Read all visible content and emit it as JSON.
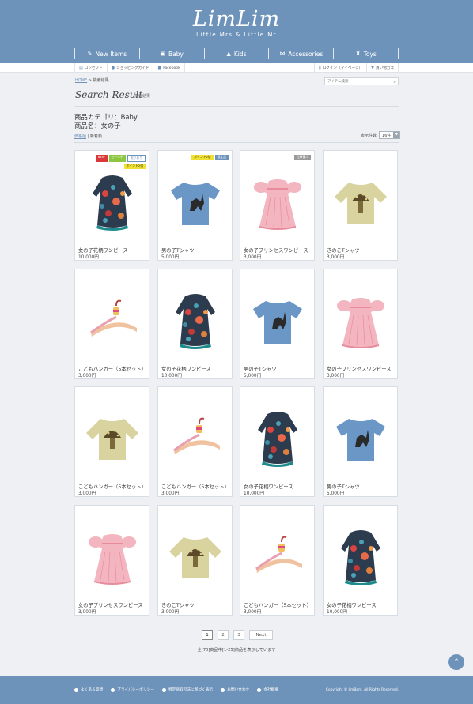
{
  "header": {
    "brand": "LimLim",
    "tagline": "Little Mrs & Little Mr",
    "nav": [
      {
        "label": "New Items",
        "icon": "pin-icon"
      },
      {
        "label": "Baby",
        "icon": "onesie-icon"
      },
      {
        "label": "Kids",
        "icon": "tshirt-icon"
      },
      {
        "label": "Accessories",
        "icon": "bow-icon"
      },
      {
        "label": "Toys",
        "icon": "toy-icon"
      }
    ]
  },
  "utility": {
    "left": [
      {
        "label": "コンセプト",
        "icon": "book-icon"
      },
      {
        "label": "ショッピングガイド",
        "icon": "info-icon"
      },
      {
        "label": "Facebook",
        "icon": "facebook-icon"
      }
    ],
    "right": [
      {
        "label": "ログイン（マイページ）",
        "icon": "lock-icon"
      },
      {
        "label": "買い物カゴ",
        "icon": "cart-icon"
      }
    ]
  },
  "breadcrumb": {
    "home": "HOME",
    "separator": ">",
    "current": "検索結果"
  },
  "search": {
    "placeholder": "アイテム検索"
  },
  "page_title": {
    "main": "Search Result",
    "sub": "検索結果"
  },
  "meta": {
    "category": "商品カテゴリ：Baby",
    "name": "商品名：女の子"
  },
  "sort": {
    "popular": "価格順",
    "divider": "|",
    "newest": "新着順"
  },
  "per_page": {
    "label": "表示件数",
    "value": "16件"
  },
  "badge_colors": {
    "new": "#d9383a",
    "sale": "#8dc63f",
    "limited": "#ffffff",
    "points": "#f0e030",
    "gray": "#9a9a9a",
    "blue": "#6e93ba"
  },
  "products": [
    {
      "name": "女の子花柄ワンピース",
      "price": "10,000円",
      "image": "dress-floral",
      "badges": [
        {
          "text": "NEW",
          "kind": "new"
        },
        {
          "text": "セール中",
          "kind": "sale"
        },
        {
          "text": "限りあり",
          "kind": "limited"
        },
        {
          "text": "ポイント2倍",
          "kind": "points"
        }
      ]
    },
    {
      "name": "男の子Tシャツ",
      "price": "5,000円",
      "image": "tshirt-blue",
      "badges": [
        {
          "text": "ポイント2倍",
          "kind": "points"
        },
        {
          "text": "限定品",
          "kind": "blue"
        }
      ]
    },
    {
      "name": "女の子プリンセスワンピース",
      "price": "3,000円",
      "image": "dress-pink",
      "badges": [
        {
          "text": "在庫僅少",
          "kind": "gray"
        }
      ]
    },
    {
      "name": "きのこTシャツ",
      "price": "3,000円",
      "image": "shirt-mushroom",
      "badges": []
    },
    {
      "name": "こどもハンガー（5本セット）",
      "price": "3,000円",
      "image": "hanger",
      "badges": []
    },
    {
      "name": "女の子花柄ワンピース",
      "price": "10,000円",
      "image": "dress-floral",
      "badges": []
    },
    {
      "name": "男の子Tシャツ",
      "price": "5,000円",
      "image": "tshirt-blue",
      "badges": []
    },
    {
      "name": "女の子プリンセスワンピース",
      "price": "3,000円",
      "image": "dress-pink",
      "badges": []
    },
    {
      "name": "こどもハンガー（5本セット）",
      "price": "3,000円",
      "image": "shirt-mushroom",
      "badges": []
    },
    {
      "name": "こどもハンガー（5本セット）",
      "price": "3,000円",
      "image": "hanger",
      "badges": []
    },
    {
      "name": "女の子花柄ワンピース",
      "price": "10,000円",
      "image": "dress-floral",
      "badges": []
    },
    {
      "name": "男の子Tシャツ",
      "price": "5,000円",
      "image": "tshirt-blue",
      "badges": []
    },
    {
      "name": "女の子プリンセスワンピース",
      "price": "3,000円",
      "image": "dress-pink",
      "badges": []
    },
    {
      "name": "きのこTシャツ",
      "price": "3,000円",
      "image": "shirt-mushroom",
      "badges": []
    },
    {
      "name": "こどもハンガー（5本セット）",
      "price": "3,000円",
      "image": "hanger",
      "badges": []
    },
    {
      "name": "女の子花柄ワンピース",
      "price": "10,000円",
      "image": "dress-floral",
      "badges": []
    }
  ],
  "pagination": {
    "pages": [
      "1",
      "2",
      "3"
    ],
    "current": "1",
    "next": "Next",
    "summary": "全[70]商品中[1-25]商品を表示しています"
  },
  "footer": {
    "links": [
      "よくある質問",
      "プライバシーポリシー",
      "特定商取引法に基づく表示",
      "お問い合わせ",
      "会社概要"
    ],
    "copyright": "Copyright © JimBom. All Rights Reserved."
  }
}
